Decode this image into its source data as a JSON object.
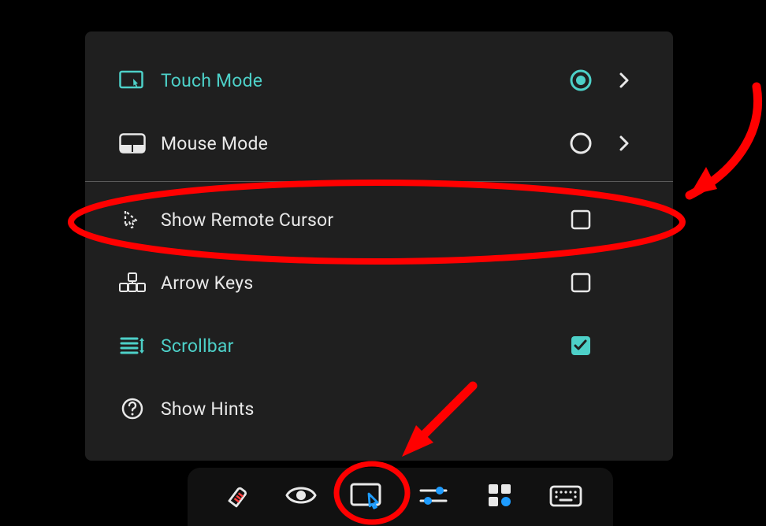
{
  "colors": {
    "accent": "#4dd0c8",
    "text": "#e8e8e8",
    "annotation": "#ff0000",
    "toolActive": "#1e9cff"
  },
  "panel": {
    "items": [
      {
        "id": "touch-mode",
        "label": "Touch Mode",
        "icon": "touch-screen-icon",
        "control": "radio",
        "selected": true,
        "chevron": true,
        "accent": true
      },
      {
        "id": "mouse-mode",
        "label": "Mouse Mode",
        "icon": "mouse-screen-icon",
        "control": "radio",
        "selected": false,
        "chevron": true,
        "accent": false
      },
      {
        "id": "show-remote-cursor",
        "label": "Show Remote Cursor",
        "icon": "cursor-dashed-icon",
        "control": "checkbox",
        "checked": false,
        "accent": false
      },
      {
        "id": "arrow-keys",
        "label": "Arrow Keys",
        "icon": "arrow-keys-icon",
        "control": "checkbox",
        "checked": false,
        "accent": false
      },
      {
        "id": "scrollbar",
        "label": "Scrollbar",
        "icon": "scrollbar-icon",
        "control": "checkbox",
        "checked": true,
        "accent": true
      },
      {
        "id": "show-hints",
        "label": "Show Hints",
        "icon": "help-circle-icon",
        "control": "none",
        "accent": false
      }
    ]
  },
  "toolbar": {
    "items": [
      {
        "id": "eraser",
        "icon": "eraser-icon",
        "active": false
      },
      {
        "id": "view",
        "icon": "eye-icon",
        "active": false
      },
      {
        "id": "pointer",
        "icon": "pointer-screen-icon",
        "active": true
      },
      {
        "id": "sliders",
        "icon": "sliders-icon",
        "active": false
      },
      {
        "id": "apps",
        "icon": "apps-grid-icon",
        "active": false
      },
      {
        "id": "keyboard",
        "icon": "keyboard-icon",
        "active": false
      }
    ]
  },
  "annotations": {
    "circledRow": "show-remote-cursor",
    "circledTool": "pointer"
  }
}
